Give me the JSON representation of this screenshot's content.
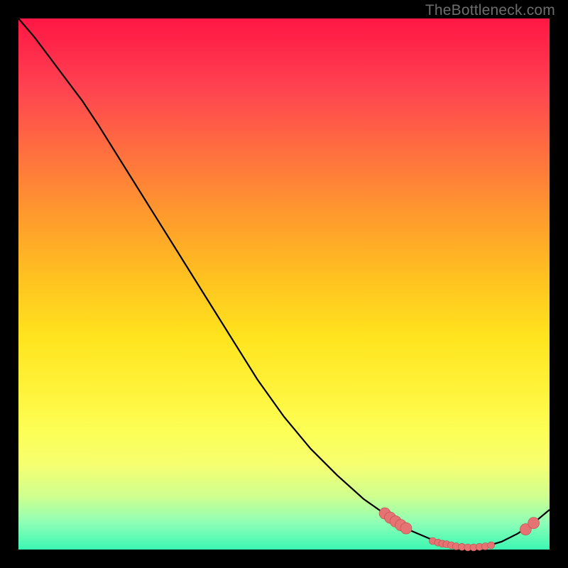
{
  "watermark": "TheBottleneck.com",
  "colors": {
    "marker_fill": "#e57373",
    "marker_stroke": "#bb4b49",
    "curve_stroke": "#000000"
  },
  "chart_data": {
    "type": "line",
    "title": "",
    "xlabel": "",
    "ylabel": "",
    "xlim": [
      0,
      1
    ],
    "ylim": [
      0,
      1
    ],
    "curve": [
      {
        "x": 0.0,
        "y": 1.0
      },
      {
        "x": 0.03,
        "y": 0.965
      },
      {
        "x": 0.06,
        "y": 0.925
      },
      {
        "x": 0.09,
        "y": 0.885
      },
      {
        "x": 0.12,
        "y": 0.845
      },
      {
        "x": 0.15,
        "y": 0.8
      },
      {
        "x": 0.2,
        "y": 0.72
      },
      {
        "x": 0.25,
        "y": 0.64
      },
      {
        "x": 0.3,
        "y": 0.56
      },
      {
        "x": 0.35,
        "y": 0.48
      },
      {
        "x": 0.4,
        "y": 0.4
      },
      {
        "x": 0.45,
        "y": 0.32
      },
      {
        "x": 0.5,
        "y": 0.25
      },
      {
        "x": 0.55,
        "y": 0.19
      },
      {
        "x": 0.6,
        "y": 0.14
      },
      {
        "x": 0.65,
        "y": 0.095
      },
      {
        "x": 0.7,
        "y": 0.06
      },
      {
        "x": 0.74,
        "y": 0.035
      },
      {
        "x": 0.78,
        "y": 0.018
      },
      {
        "x": 0.82,
        "y": 0.008
      },
      {
        "x": 0.85,
        "y": 0.004
      },
      {
        "x": 0.88,
        "y": 0.006
      },
      {
        "x": 0.91,
        "y": 0.015
      },
      {
        "x": 0.94,
        "y": 0.03
      },
      {
        "x": 0.97,
        "y": 0.05
      },
      {
        "x": 1.0,
        "y": 0.075
      }
    ],
    "big_markers": [
      {
        "x": 0.69,
        "y": 0.068,
        "r": 8
      },
      {
        "x": 0.7,
        "y": 0.06,
        "r": 8
      },
      {
        "x": 0.71,
        "y": 0.053,
        "r": 8
      },
      {
        "x": 0.72,
        "y": 0.046,
        "r": 8
      },
      {
        "x": 0.73,
        "y": 0.04,
        "r": 8
      },
      {
        "x": 0.955,
        "y": 0.038,
        "r": 8
      },
      {
        "x": 0.97,
        "y": 0.05,
        "r": 8
      }
    ],
    "small_markers": [
      {
        "x": 0.78,
        "y": 0.016,
        "r": 5
      },
      {
        "x": 0.79,
        "y": 0.013,
        "r": 5
      },
      {
        "x": 0.798,
        "y": 0.011,
        "r": 5
      },
      {
        "x": 0.806,
        "y": 0.01,
        "r": 5
      },
      {
        "x": 0.815,
        "y": 0.008,
        "r": 5
      },
      {
        "x": 0.824,
        "y": 0.006,
        "r": 5
      },
      {
        "x": 0.835,
        "y": 0.005,
        "r": 5
      },
      {
        "x": 0.846,
        "y": 0.004,
        "r": 5
      },
      {
        "x": 0.857,
        "y": 0.004,
        "r": 5
      },
      {
        "x": 0.868,
        "y": 0.005,
        "r": 5
      },
      {
        "x": 0.879,
        "y": 0.006,
        "r": 5
      },
      {
        "x": 0.89,
        "y": 0.008,
        "r": 5
      }
    ]
  }
}
